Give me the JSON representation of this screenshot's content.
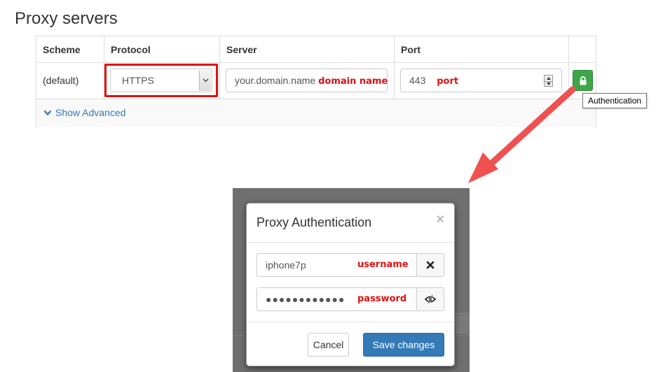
{
  "page": {
    "title": "Proxy servers"
  },
  "table": {
    "headers": [
      "Scheme",
      "Protocol",
      "Server",
      "Port"
    ],
    "row": {
      "scheme": "(default)",
      "protocol": "HTTPS",
      "server": "your.domain.name",
      "server_annotation": "domain name",
      "port": "443",
      "port_annotation": "port"
    },
    "show_advanced": "Show Advanced",
    "auth_tooltip": "Authentication"
  },
  "modal": {
    "title": "Proxy Authentication",
    "close": "×",
    "username": "iphone7p",
    "username_annotation": "username",
    "password_mask": "●●●●●●●●●●●●",
    "password_annotation": "password",
    "cancel_label": "Cancel",
    "save_label": "Save changes"
  },
  "colors": {
    "annotation": "#e01010",
    "auth_button": "#3ea649",
    "primary": "#337ab7",
    "link": "#337ab7"
  },
  "icons": {
    "auth": "lock-icon",
    "clear": "x-mark-icon",
    "reveal": "eye-slash-icon",
    "advanced": "chevron-down-icon",
    "select": "chevron-down-icon"
  }
}
